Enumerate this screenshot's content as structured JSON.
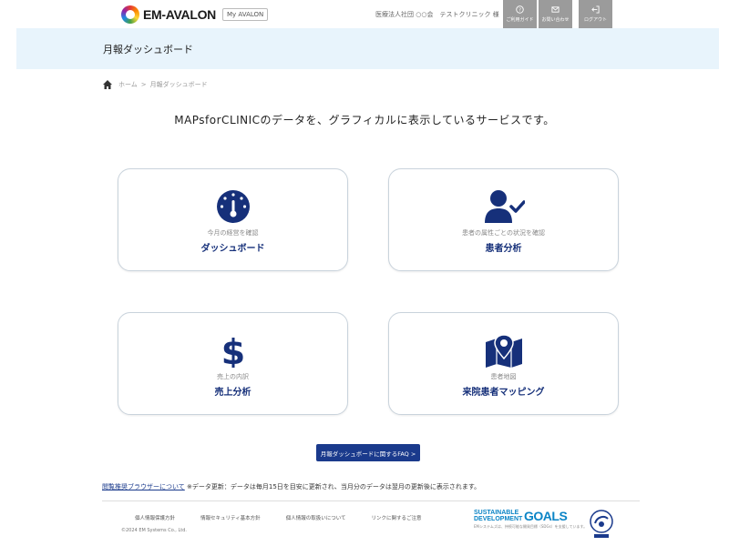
{
  "header": {
    "logo_text": "EM-AVALON",
    "logo_sub": "My AVALON",
    "org_text": "医療法人社団 ○○会　テストクリニック 様",
    "buttons": [
      {
        "label": "ご利用ガイド",
        "icon": "question-icon"
      },
      {
        "label": "お問い合わせ",
        "icon": "mail-icon"
      },
      {
        "label": "ログアウト",
        "icon": "logout-icon"
      }
    ],
    "button_color": "#9b9b9b"
  },
  "page": {
    "title": "月報ダッシュボード",
    "breadcrumb": {
      "home": "ホーム",
      "separator": ">",
      "current": "月報ダッシュボード"
    },
    "intro": "MAPsforCLINICのデータを、グラフィカルに表示しているサービスです。"
  },
  "cards": [
    {
      "sub": "今月の経営を確認",
      "title": "ダッシュボード",
      "icon": "gauge-icon"
    },
    {
      "sub": "患者の属性ごとの状況を確認",
      "title": "患者分析",
      "icon": "patient-check-icon"
    },
    {
      "sub": "売上の内訳",
      "title": "売上分析",
      "icon": "dollar-icon"
    },
    {
      "sub": "患者地図",
      "title": "来院患者マッピング",
      "icon": "map-pin-icon"
    }
  ],
  "faq_button": "月報ダッシュボードに関するFAQ >",
  "note": {
    "link": "閲覧推奨ブラウザーについて",
    "text": "※データ更新：データは毎月15日を目安に更新され、当月分のデータは翌月の更新後に表示されます。"
  },
  "footer": {
    "links": [
      "個人情報保護方針",
      "情報セキュリティ基本方針",
      "個人情報の取扱いについて",
      "リンクに関するご注意"
    ],
    "copyright": "©2024 EM Systems Co., Ltd.",
    "sdg_line1": "SUSTAINABLE",
    "sdg_line2": "DEVELOPMENT",
    "sdg_goals": "GOALS",
    "sdg_note": "EMシステムズは、持続可能な開発目標（SDGs）を支援しています。"
  },
  "colors": {
    "accent": "#16307a",
    "titlebar_bg": "#e8f4fc",
    "faq_bg": "#1a3a8c"
  }
}
